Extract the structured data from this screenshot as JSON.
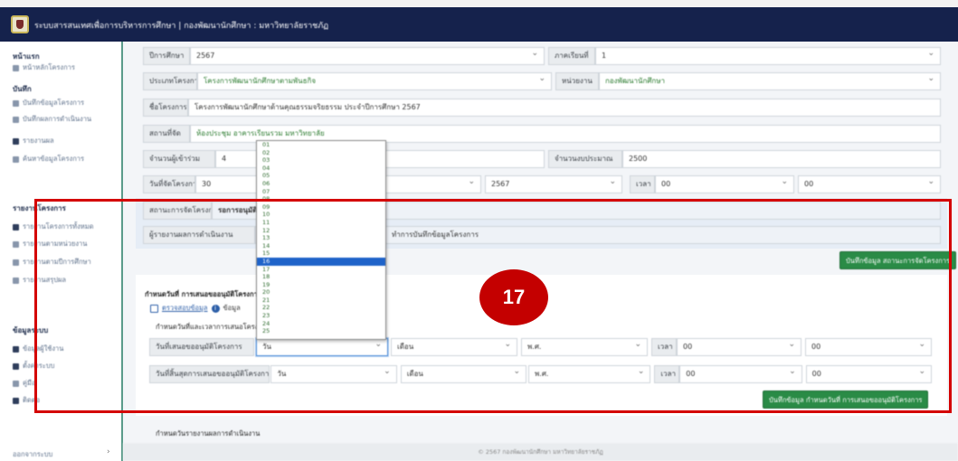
{
  "header": {
    "title": "ระบบสารสนเทศเพื่อการบริหารการศึกษา | กองพัฒนานักศึกษา : มหาวิทยาลัยราชภัฏ"
  },
  "sidebar": {
    "home_heading": "หน้าแรก",
    "home_items": [
      "หน้าหลักโครงการ"
    ],
    "record_heading": "บันทึก",
    "record_items": [
      "บันทึกข้อมูลโครงการ",
      "บันทึกผลการดำเนินงาน",
      "รายงานผล",
      "ค้นหาข้อมูลโครงการ"
    ],
    "report_heading": "รายงานโครงการ",
    "report_items": [
      "รายงานโครงการทั้งหมด",
      "รายงานตามหน่วยงาน",
      "รายงานตามปีการศึกษา",
      "รายงานสรุปผล"
    ],
    "system_heading": "ข้อมูลระบบ",
    "system_items": [
      "ข้อมูลผู้ใช้งาน",
      "ตั้งค่าระบบ",
      "คู่มือ",
      "ติดต่อ"
    ],
    "logout": "ออกจากระบบ"
  },
  "form": {
    "year_label": "ปีการศึกษา",
    "year_value": "2567",
    "term_label": "ภาคเรียนที่",
    "term_value": "1",
    "type_label": "ประเภทโครงการ",
    "type_value": "โครงการพัฒนานักศึกษาตามพันธกิจ",
    "unit_label": "หน่วยงาน",
    "unit_value": "กองพัฒนานักศึกษา",
    "name_label": "ชื่อโครงการ",
    "name_value": "โครงการพัฒนานักศึกษาด้านคุณธรรมจริยธรรม ประจำปีการศึกษา 2567",
    "place_label": "สถานที่จัด",
    "place_value": "ห้องประชุม อาคารเรียนรวม มหาวิทยาลัย",
    "participants_label": "จำนวนผู้เข้าร่วม",
    "participants_value": "4",
    "budget_label": "จำนวนงบประมาณ",
    "budget_value": "2500",
    "date_label": "วันที่จัดโครงการ",
    "date_day": "30",
    "date_year": "2567",
    "time_label": "เวลา",
    "date_hour": "00",
    "date_minute": "00",
    "status_label": "สถานะการจัดโครงการ",
    "status_value": "รอการอนุมัติ",
    "reporter_label": "ผู้รายงานผลการดำเนินงาน",
    "reporter_value": "ทำการบันทึกข้อมูลโครงการ",
    "save_status_button": "บันทึกข้อมูล สถานะการจัดโครงการ"
  },
  "approval": {
    "heading": "กำหนดวันที่ การเสนอขออนุมัติโครงการ",
    "check_link": "ตรวจสอบข้อมูล",
    "info_text": "ข้อมูล",
    "subheading": "กำหนดวันที่และเวลาการเสนอโครงการ",
    "start_label": "วันที่เสนอขออนุมัติโครงการ",
    "end_label": "วันที่สิ้นสุดการเสนอขออนุมัติโครงการ",
    "day_placeholder": "วัน",
    "month_placeholder": "เดือน",
    "year_placeholder": "พ.ศ.",
    "time_label": "เวลา",
    "hour": "00",
    "minute": "00",
    "save_button": "บันทึกข้อมูล กำหนดวันที่ การเสนอขออนุมัติโครงการ"
  },
  "dropdown": {
    "options": [
      "01",
      "02",
      "03",
      "04",
      "05",
      "06",
      "07",
      "08",
      "09",
      "10",
      "11",
      "12",
      "13",
      "14",
      "15",
      "16",
      "17",
      "18",
      "19",
      "20",
      "21",
      "22",
      "23",
      "24",
      "25"
    ],
    "selected_index": 15
  },
  "report_next_heading": "กำหนดวันรายงานผลการดำเนินงาน",
  "badge": "17",
  "footer": "© 2567 กองพัฒนานักศึกษา มหาวิทยาลัยราชภัฏ",
  "colors": {
    "header": "#15224c",
    "annotation": "#d40000",
    "button": "#2a8b46",
    "highlight": "#1f63c9"
  }
}
